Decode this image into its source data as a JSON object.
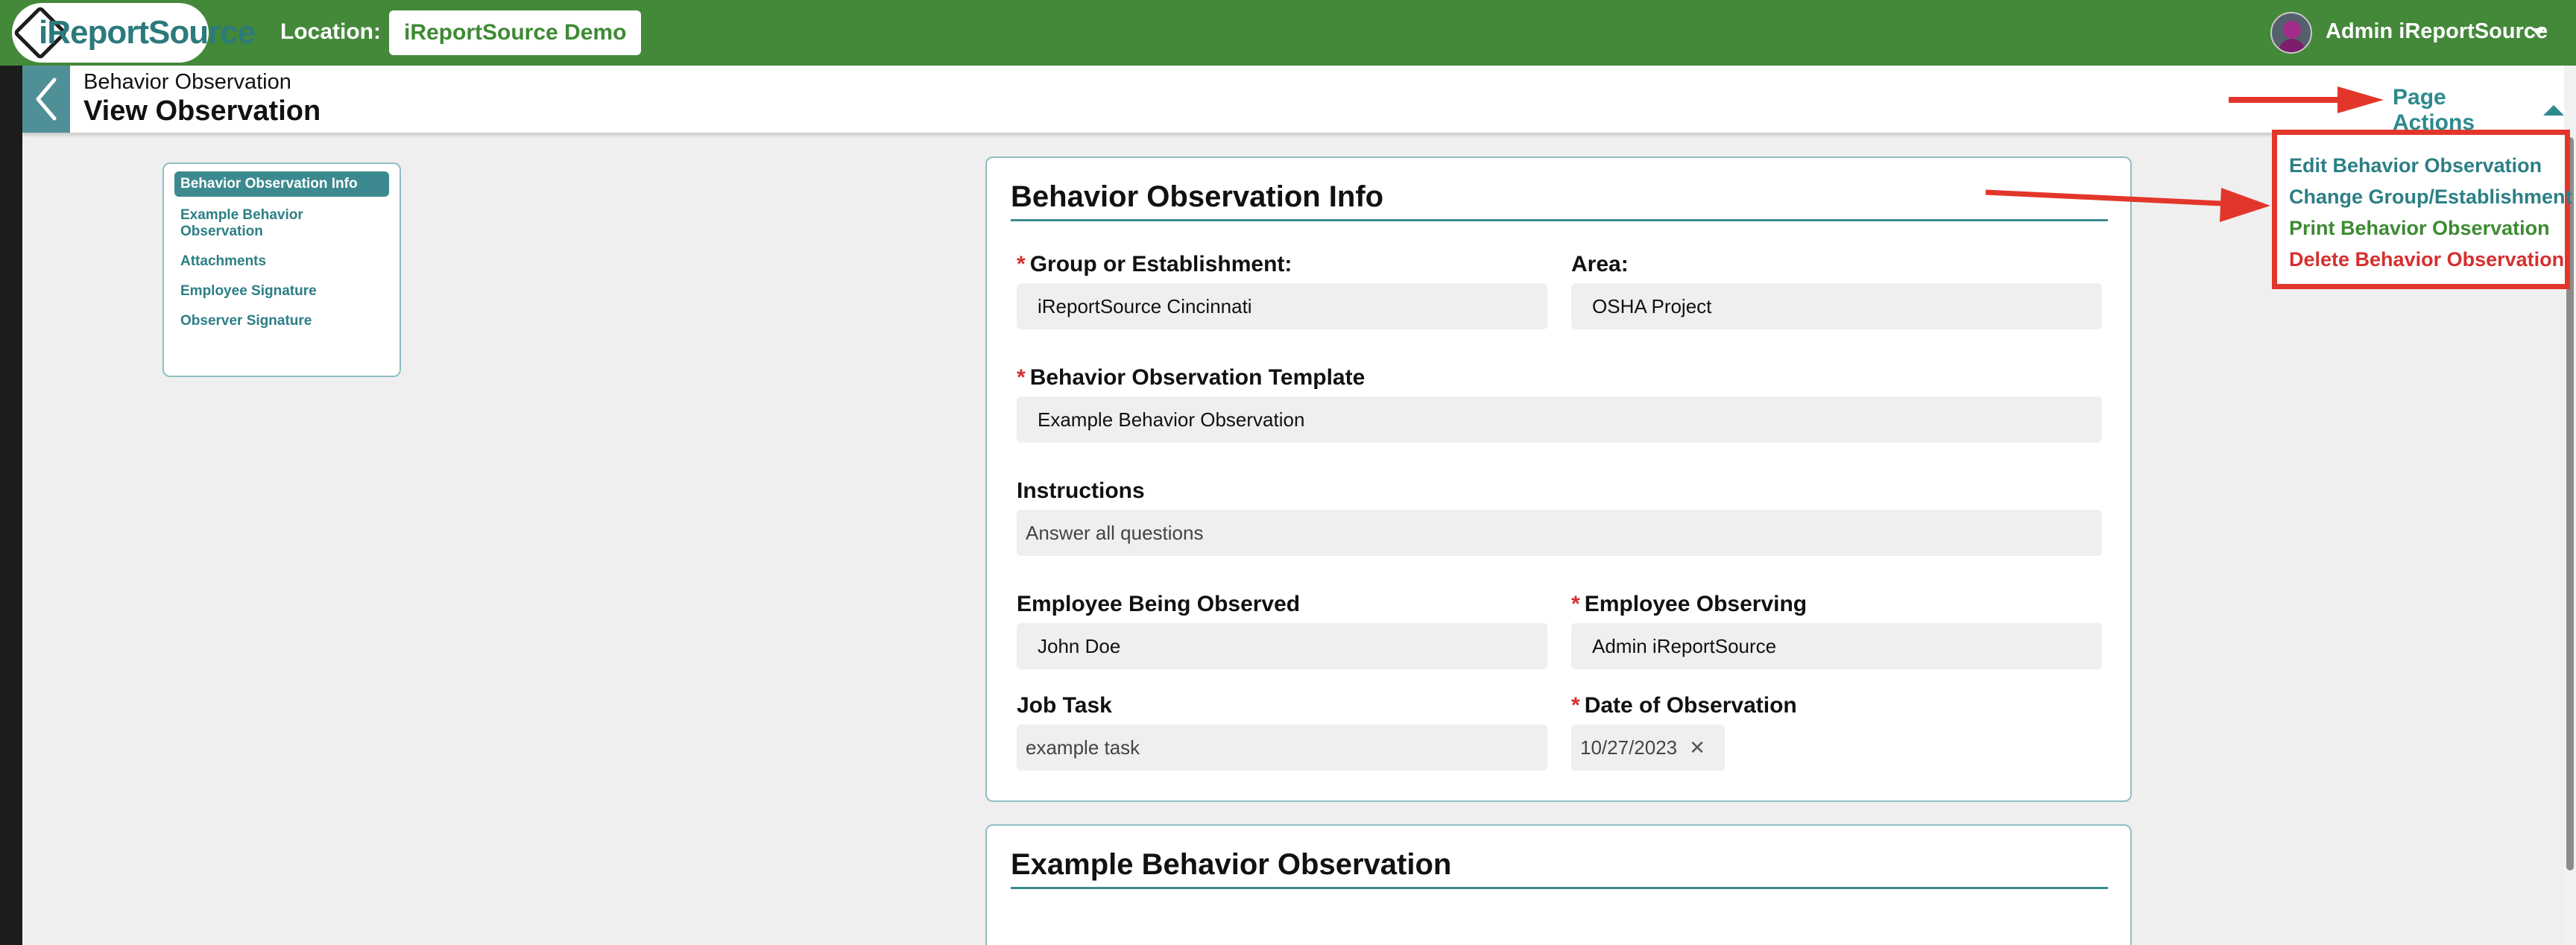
{
  "topbar": {
    "logo_text": "iReportSource",
    "location_label": "Location:",
    "location_value": "iReportSource Demo",
    "user_name": "Admin iReportSource"
  },
  "header": {
    "breadcrumb": "Behavior Observation",
    "title": "View Observation",
    "page_actions_label": "Page Actions"
  },
  "sidenav": {
    "items": [
      {
        "label": "Behavior Observation Info",
        "active": true
      },
      {
        "label": "Example Behavior Observation",
        "active": false
      },
      {
        "label": "Attachments",
        "active": false
      },
      {
        "label": "Employee Signature",
        "active": false
      },
      {
        "label": "Observer Signature",
        "active": false
      }
    ]
  },
  "info_card": {
    "title": "Behavior Observation Info",
    "fields": {
      "group": {
        "label": "Group or Establishment:",
        "required": true,
        "value": "iReportSource Cincinnati"
      },
      "area": {
        "label": "Area:",
        "required": false,
        "value": "OSHA Project"
      },
      "template": {
        "label": "Behavior Observation Template",
        "required": true,
        "value": "Example Behavior Observation"
      },
      "instructions": {
        "label": "Instructions",
        "required": false,
        "value": "Answer all questions"
      },
      "employee_observed": {
        "label": "Employee Being Observed",
        "required": false,
        "value": "John Doe"
      },
      "employee_observing": {
        "label": "Employee Observing",
        "required": true,
        "value": "Admin iReportSource"
      },
      "job_task": {
        "label": "Job Task",
        "required": false,
        "value": "example task"
      },
      "date": {
        "label": "Date of Observation",
        "required": true,
        "value": "10/27/2023"
      }
    },
    "required_marker": "*"
  },
  "example_card": {
    "title": "Example Behavior Observation"
  },
  "page_actions_menu": [
    {
      "label": "Edit Behavior Observation",
      "color": "#2c7f85"
    },
    {
      "label": "Change Group/Establishment",
      "color": "#2c7f85"
    },
    {
      "label": "Print Behavior Observation",
      "color": "#3d8a33"
    },
    {
      "label": "Delete Behavior Observation",
      "color": "#d62f2f"
    }
  ],
  "colors": {
    "topbar": "#44883a",
    "accent_teal": "#2c8a8f",
    "annotation_red": "#e3362b"
  }
}
